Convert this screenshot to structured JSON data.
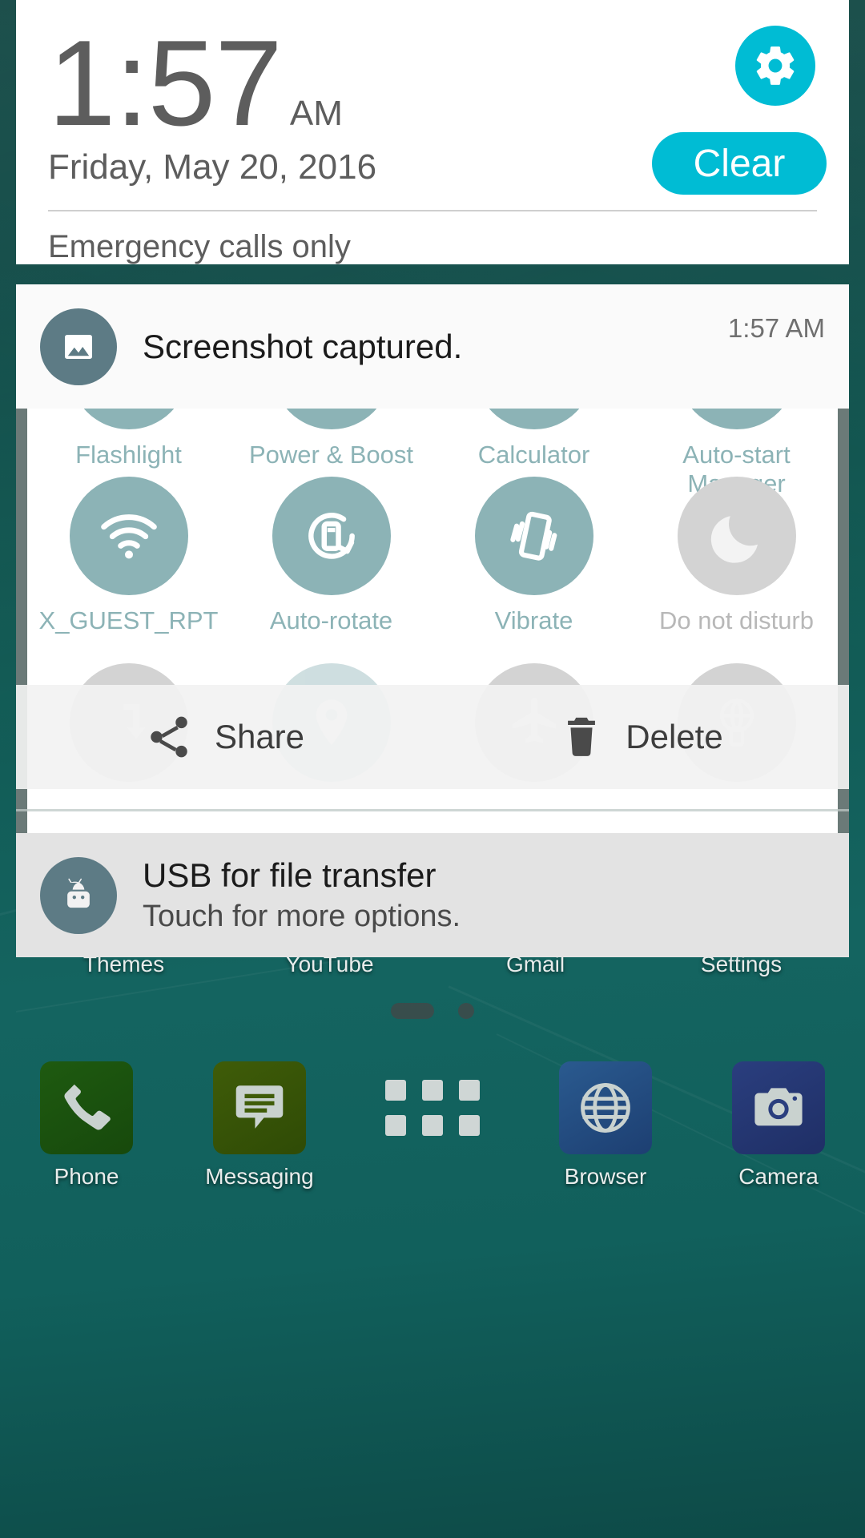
{
  "theme": {
    "accent": "#00bcd4",
    "tile_on": "#8cb3b6",
    "tile_off": "#d3d3d3",
    "wallpaper": "#115953",
    "notif_icon_bg": "#5d7b85"
  },
  "header": {
    "time": "1:57",
    "ampm": "AM",
    "date": "Friday, May 20, 2016",
    "carrier": "Emergency calls only",
    "clear_label": "Clear",
    "settings_icon": "gear-icon"
  },
  "notifications": [
    {
      "id": "screenshot",
      "icon": "image-icon",
      "title": "Screenshot captured.",
      "subtitle": "",
      "time": "1:57 AM"
    },
    {
      "id": "usb",
      "icon": "android-robot-icon",
      "title": "USB for file transfer",
      "subtitle": "Touch for more options.",
      "time": ""
    }
  ],
  "screenshot_actions": [
    {
      "label": "Share",
      "icon": "share-icon"
    },
    {
      "label": "Delete",
      "icon": "trash-icon"
    }
  ],
  "quick_settings": {
    "row_top": [
      {
        "label": "Flashlight",
        "icon": "flashlight-icon",
        "state": "on"
      },
      {
        "label": "Power & Boost",
        "icon": "power-boost-icon",
        "state": "on"
      },
      {
        "label": "Calculator",
        "icon": "calculator-icon",
        "state": "on"
      },
      {
        "label": "Auto-start\nManager",
        "icon": "autostart-icon",
        "state": "on"
      }
    ],
    "row_middle": [
      {
        "label": "X_GUEST_RPT",
        "icon": "wifi-icon",
        "state": "on"
      },
      {
        "label": "Auto-rotate",
        "icon": "auto-rotate-icon",
        "state": "on"
      },
      {
        "label": "Vibrate",
        "icon": "vibrate-icon",
        "state": "on"
      },
      {
        "label": "Do not disturb",
        "icon": "moon-icon",
        "state": "off"
      }
    ],
    "row_bottom": [
      {
        "label": "",
        "icon": "sync-icon",
        "state": "off"
      },
      {
        "label": "",
        "icon": "location-icon",
        "state": "on"
      },
      {
        "label": "",
        "icon": "airplane-icon",
        "state": "off"
      },
      {
        "label": "",
        "icon": "hotspot-icon",
        "state": "off"
      }
    ]
  },
  "home_screen": {
    "apps": [
      {
        "label": "Themes"
      },
      {
        "label": "YouTube"
      },
      {
        "label": "Gmail"
      },
      {
        "label": "Settings"
      }
    ],
    "page_indicator": {
      "current": 1,
      "total": 2
    }
  },
  "dock": {
    "items": [
      {
        "label": "Phone",
        "icon": "phone-icon"
      },
      {
        "label": "Messaging",
        "icon": "message-icon"
      },
      {
        "label": "",
        "icon": "app-drawer-icon"
      },
      {
        "label": "Browser",
        "icon": "globe-icon"
      },
      {
        "label": "Camera",
        "icon": "camera-icon"
      }
    ]
  }
}
